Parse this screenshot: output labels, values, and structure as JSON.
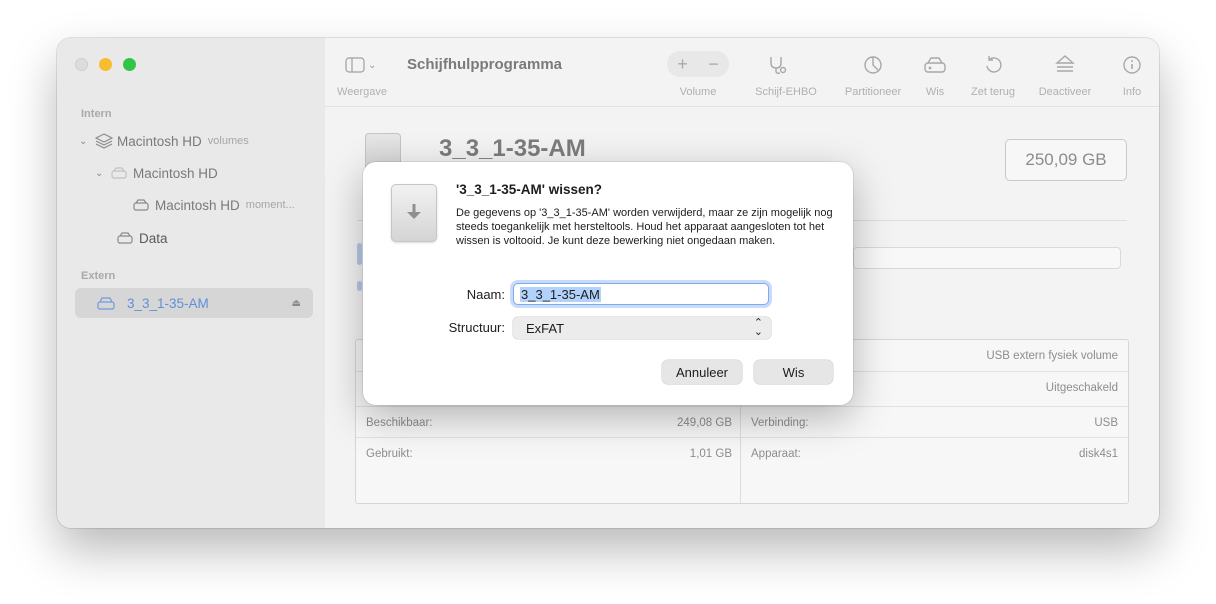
{
  "app": {
    "title": "Schijfhulpprogramma"
  },
  "toolbar": {
    "view_label": "Weergave",
    "volume_label": "Volume",
    "first_aid_label": "Schijf-EHBO",
    "partition_label": "Partitioneer",
    "erase_label": "Wis",
    "restore_label": "Zet terug",
    "unmount_label": "Deactiveer",
    "info_label": "Info"
  },
  "sidebar": {
    "section_internal": "Intern",
    "section_external": "Extern",
    "items": [
      {
        "label": "Macintosh HD",
        "sublabel": "volumes"
      },
      {
        "label": "Macintosh HD"
      },
      {
        "label": "Macintosh HD",
        "sublabel": "moment..."
      },
      {
        "label": "Data"
      },
      {
        "label": "3_3_1-35-AM"
      }
    ]
  },
  "main": {
    "volume_title": "3_3_1-35-AM",
    "capacity": "250,09 GB",
    "info": [
      {
        "left_label": "",
        "left_value": "",
        "right_label": "",
        "right_value": "USB extern fysiek volume"
      },
      {
        "left_label": "",
        "left_value": "",
        "right_label": "",
        "right_value": "Uitgeschakeld"
      },
      {
        "left_label": "Beschikbaar:",
        "left_value": "249,08 GB",
        "right_label": "Verbinding:",
        "right_value": "USB"
      },
      {
        "left_label": "Gebruikt:",
        "left_value": "1,01 GB",
        "right_label": "Apparaat:",
        "right_value": "disk4s1"
      }
    ]
  },
  "dialog": {
    "title": "'3_3_1-35-AM' wissen?",
    "message": "De gegevens op '3_3_1-35-AM' worden verwijderd, maar ze zijn mogelijk nog steeds toegankelijk met hersteltools. Houd het apparaat aangesloten tot het wissen is voltooid. Je kunt deze bewerking niet ongedaan maken.",
    "name_label": "Naam:",
    "name_value": "3_3_1-35-AM",
    "format_label": "Structuur:",
    "format_value": "ExFAT",
    "cancel_label": "Annuleer",
    "erase_label": "Wis"
  },
  "colors": {
    "accent": "#5f90d8",
    "close": "#dcdcdc",
    "minimize": "#f7bd2f",
    "maximize": "#32c545"
  }
}
